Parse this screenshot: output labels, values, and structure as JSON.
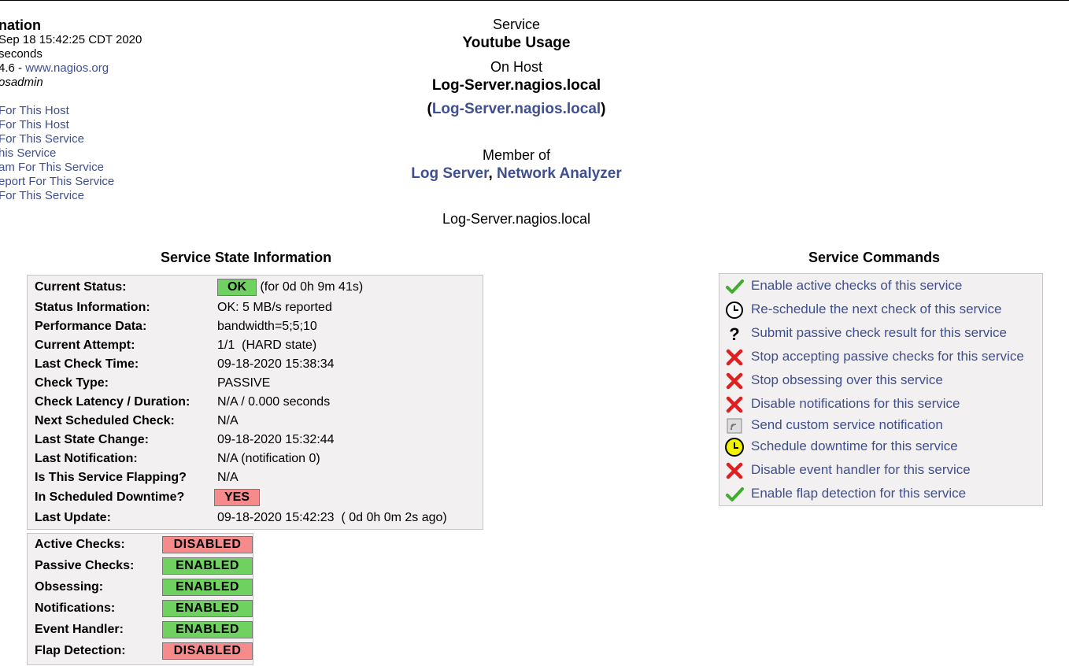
{
  "info": {
    "title": "nation",
    "lines": [
      "Sep 18 15:42:25 CDT 2020",
      "seconds"
    ],
    "version_prefix": "4.6 - ",
    "version_link": "www.nagios.org",
    "user": "osadmin",
    "links": [
      "For This Host",
      " For This Host",
      " For This Service",
      "his Service",
      "am For This Service",
      "eport For This Service",
      " For This Service"
    ]
  },
  "header": {
    "service_label": "Service",
    "service_name": "Youtube Usage",
    "host_label": "On Host",
    "host_name": "Log-Server.nagios.local",
    "host_alias_open": "(",
    "host_alias": "Log-Server.nagios.local",
    "host_alias_close": ")",
    "member_label": "Member of",
    "group1": "Log Server",
    "group_sep": ", ",
    "group2": "Network Analyzer",
    "address": "Log-Server.nagios.local"
  },
  "state": {
    "title": "Service State Information",
    "rows": [
      {
        "k": "Current Status:",
        "v": "(for 0d 0h 9m 41s)",
        "badge": "OK"
      },
      {
        "k": "Status Information:",
        "v": "OK: 5 MB/s reported"
      },
      {
        "k": "Performance Data:",
        "v": "bandwidth=5;5;10"
      },
      {
        "k": "Current Attempt:",
        "v": "1/1  (HARD state)"
      },
      {
        "k": "Last Check Time:",
        "v": "09-18-2020 15:38:34"
      },
      {
        "k": "Check Type:",
        "v": "PASSIVE"
      },
      {
        "k": "Check Latency / Duration:",
        "v": "N/A / 0.000 seconds"
      },
      {
        "k": "Next Scheduled Check:",
        "v": "N/A"
      },
      {
        "k": "Last State Change:",
        "v": "09-18-2020 15:32:44"
      },
      {
        "k": "Last Notification:",
        "v": "N/A (notification 0)"
      },
      {
        "k": "Is This Service Flapping?",
        "v": "N/A"
      },
      {
        "k": "In Scheduled Downtime?",
        "badge": "YES"
      },
      {
        "k": "Last Update:",
        "v": "09-18-2020 15:42:23  ( 0d 0h 0m 2s ago)"
      }
    ],
    "colors": {
      "ok": "#6fd160",
      "bad": "#f78b8b",
      "link": "#3f4f8f"
    }
  },
  "flags": [
    {
      "k": "Active Checks:",
      "v": "DISABLED"
    },
    {
      "k": "Passive Checks:",
      "v": "ENABLED"
    },
    {
      "k": "Obsessing:",
      "v": "ENABLED"
    },
    {
      "k": "Notifications:",
      "v": "ENABLED"
    },
    {
      "k": "Event Handler:",
      "v": "ENABLED"
    },
    {
      "k": "Flap Detection:",
      "v": "DISABLED"
    }
  ],
  "commands": {
    "title": "Service Commands",
    "items": [
      {
        "icon": "check-icon",
        "label": "Enable active checks of this service"
      },
      {
        "icon": "clock-icon",
        "label": "Re-schedule the next check of this service"
      },
      {
        "icon": "question-icon",
        "label": "Submit passive check result for this service"
      },
      {
        "icon": "x-icon",
        "label": "Stop accepting passive checks for this service"
      },
      {
        "icon": "x-icon",
        "label": "Stop obsessing over this service"
      },
      {
        "icon": "x-icon",
        "label": "Disable notifications for this service"
      },
      {
        "icon": "notification-icon",
        "label": "Send custom service notification"
      },
      {
        "icon": "downtime-clock-icon",
        "label": "Schedule downtime for this service"
      },
      {
        "icon": "x-icon",
        "label": "Disable event handler for this service"
      },
      {
        "icon": "check-icon",
        "label": "Enable flap detection for this service"
      }
    ]
  }
}
